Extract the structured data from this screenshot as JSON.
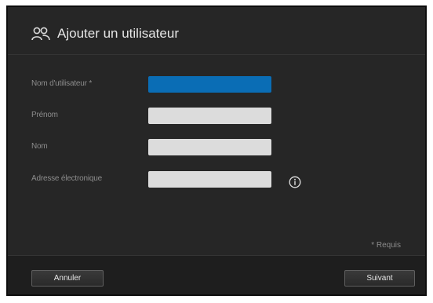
{
  "dialog": {
    "title": "Ajouter un utilisateur",
    "title_icon": "users-icon"
  },
  "form": {
    "fields": [
      {
        "label": "Nom d'utilisateur *",
        "value": "",
        "placeholder": "",
        "state": "focused"
      },
      {
        "label": "Prénom",
        "value": "",
        "placeholder": ""
      },
      {
        "label": "Nom",
        "value": "",
        "placeholder": ""
      },
      {
        "label": "Adresse électronique",
        "value": "",
        "placeholder": "",
        "icon": "info-icon"
      }
    ],
    "required_note": "* Requis"
  },
  "footer": {
    "cancel_label": "Annuler",
    "next_label": "Suivant"
  },
  "colors": {
    "background": "#262626",
    "focused_input": "#0a6db5",
    "input": "#dcdcdc",
    "label_text": "#8c8c8c",
    "title_text": "#e6e6e6"
  }
}
